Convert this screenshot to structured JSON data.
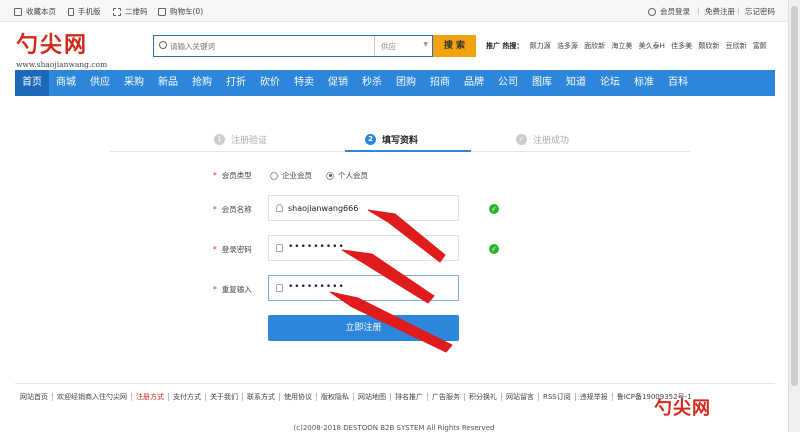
{
  "topbar": {
    "bookmark": "收藏本页",
    "mobile": "手机版",
    "qrcode": "二维码",
    "cart": "购物车(0)",
    "login": "会员登录",
    "register": "免费注册",
    "forgot": "忘记密码",
    "separator": "|"
  },
  "logo": {
    "text": "勺尖网",
    "url": "www.shaojianwang.com"
  },
  "search": {
    "placeholder": "请输入关键词",
    "category": "供应",
    "button": "搜 索"
  },
  "hot": {
    "label": "推广 热搜：",
    "items": [
      "颇力源",
      "浩多源",
      "面欣新",
      "海立美",
      "美久泰H",
      "佳多美",
      "颇欣新",
      "豆欣新",
      "富颇"
    ]
  },
  "nav": [
    "首页",
    "商城",
    "供应",
    "采购",
    "新品",
    "抢购",
    "打折",
    "砍价",
    "特卖",
    "促销",
    "秒杀",
    "团购",
    "招商",
    "品牌",
    "公司",
    "图库",
    "知道",
    "论坛",
    "标准",
    "百科"
  ],
  "steps": [
    {
      "num": "1",
      "label": "注册验证"
    },
    {
      "num": "2",
      "label": "填写资料"
    },
    {
      "num": "✓",
      "label": "注册成功"
    }
  ],
  "form": {
    "required_mark": "*",
    "member_type_label": "会员类型",
    "member_type_options": [
      "企业会员",
      "个人会员"
    ],
    "member_type_selected": "个人会员",
    "username_label": "会员名称",
    "username_value": "shaojianwang666",
    "password_label": "登录密码",
    "password_value": "•••••••••",
    "confirm_label": "重复输入",
    "confirm_value": "•••••••••",
    "submit": "立即注册",
    "check_mark": "✓"
  },
  "footer": {
    "links": [
      "网站首页",
      "欢迎经销商入住勺尖网",
      "注册方式",
      "支付方式",
      "关于我们",
      "联系方式",
      "使用协议",
      "版权隐私",
      "网站地图",
      "排名推广",
      "广告服务",
      "积分换礼",
      "网站留言",
      "RSS订阅",
      "违规举报",
      "鲁ICP备19009352号-1"
    ],
    "highlight": "注册方式",
    "copyright": "(c)2008-2018 DESTOON B2B SYSTEM All Rights Reserved",
    "watermark": "勺尖网"
  },
  "colors": {
    "nav_blue": "#2c86dc",
    "search_button": "#f3a30d",
    "logo_red": "#d4281b",
    "arrow_red": "#e01b1b",
    "check_green": "#2db52d"
  }
}
